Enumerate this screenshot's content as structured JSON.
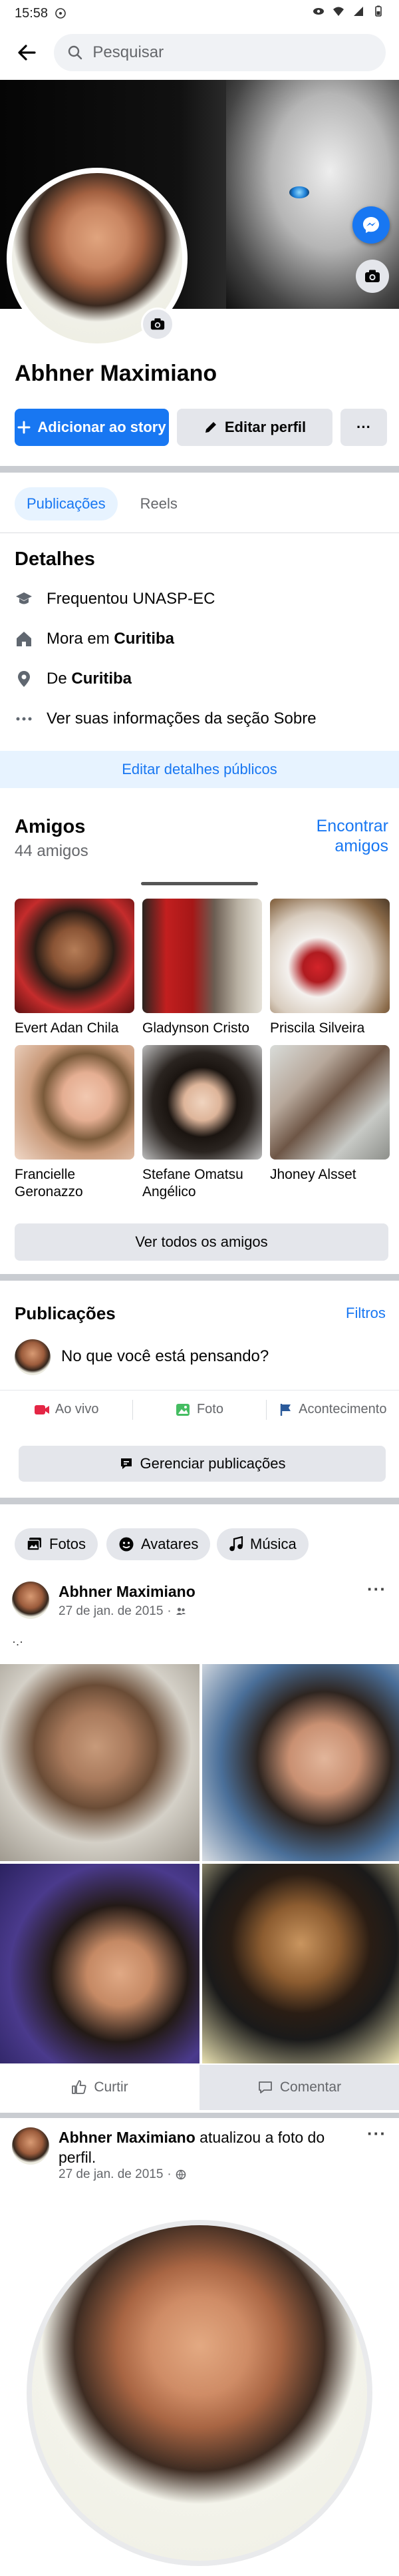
{
  "status_bar": {
    "time": "15:58"
  },
  "search": {
    "placeholder": "Pesquisar"
  },
  "profile": {
    "name": "Abhner Maximiano",
    "add_story_label": "Adicionar ao story",
    "edit_profile_label": "Editar perfil",
    "more_label": "···"
  },
  "tabs": [
    {
      "label": "Publicações",
      "active": true
    },
    {
      "label": "Reels",
      "active": false
    }
  ],
  "details": {
    "title": "Detalhes",
    "studied": "Frequentou UNASP-EC",
    "lives_prefix": "Mora em ",
    "lives_city": "Curitiba",
    "from_prefix": "De ",
    "from_city": "Curitiba",
    "about": "Ver suas informações da seção Sobre",
    "edit_label": "Editar detalhes públicos"
  },
  "friends": {
    "title": "Amigos",
    "count": "44 amigos",
    "find_label": "Encontrar amigos",
    "see_all_label": "Ver todos os amigos",
    "list": [
      {
        "name": "Evert Adan Chila"
      },
      {
        "name": "Gladynson Cristo"
      },
      {
        "name": "Priscila Silveira"
      },
      {
        "name": "Francielle Geronazzo"
      },
      {
        "name": "Stefane Omatsu Angélico"
      },
      {
        "name": "Jhoney Alsset"
      }
    ]
  },
  "publications": {
    "title": "Publicações",
    "filters_label": "Filtros",
    "composer_placeholder": "No que você está pensando?",
    "live_label": "Ao vivo",
    "photo_label": "Foto",
    "event_label": "Acontecimento",
    "manage_label": "Gerenciar publicações"
  },
  "chips": [
    {
      "label": "Fotos"
    },
    {
      "label": "Avatares"
    },
    {
      "label": "Música"
    }
  ],
  "post1": {
    "author": "Abhner Maximiano",
    "date": "27 de jan. de 2015",
    "text": "·.·",
    "like_label": "Curtir",
    "comment_label": "Comentar"
  },
  "post2": {
    "author": "Abhner Maximiano",
    "action": " atualizou a foto do perfil.",
    "date": "27 de jan. de 2015"
  },
  "colors": {
    "accent": "#1877f2",
    "accent_light": "#e7f3ff",
    "button_gray": "#e4e6eb",
    "live_red": "#e42645",
    "photo_green": "#45bd62"
  }
}
